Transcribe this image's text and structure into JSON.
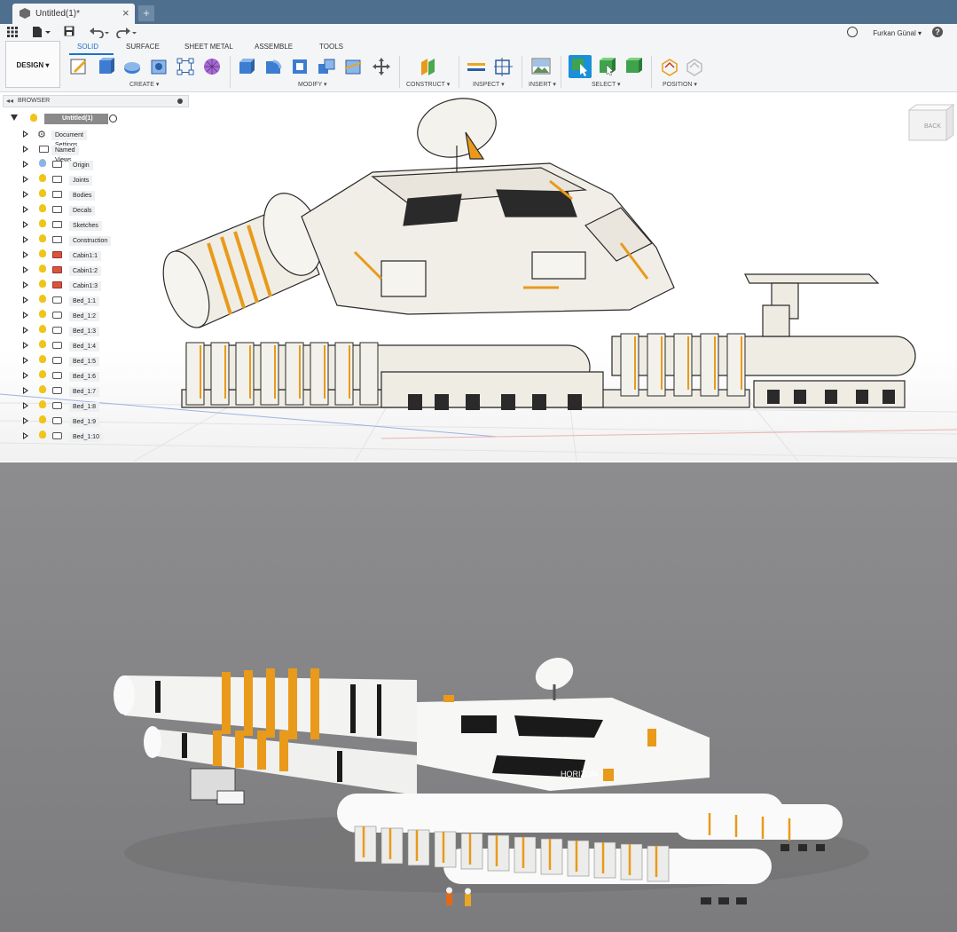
{
  "window": {
    "tab_title": "Untitled(1)*",
    "tab_close": "×",
    "new_tab": "+"
  },
  "user": {
    "name": "Furkan Günal ▾",
    "help": "?"
  },
  "workspace": {
    "mode_label": "DESIGN ▾"
  },
  "workspace_tabs": [
    "SOLID",
    "SURFACE",
    "SHEET METAL",
    "ASSEMBLE",
    "TOOLS"
  ],
  "tool_groups": {
    "create": "CREATE ▾",
    "modify": "MODIFY ▾",
    "construct": "CONSTRUCT ▾",
    "inspect": "INSPECT ▾",
    "insert": "INSERT ▾",
    "select": "SELECT ▾",
    "position": "POSITION ▾"
  },
  "browser": {
    "title": "BROWSER",
    "root": "Untitled(1)",
    "items": [
      "Document Settings",
      "Named Views",
      "Origin",
      "Joints",
      "Bodies",
      "Decals",
      "Sketches",
      "Construction",
      "Cabin1:1",
      "Cabin1:2",
      "Cabin1:3",
      "Bed_1:1",
      "Bed_1:2",
      "Bed_1:3",
      "Bed_1:4",
      "Bed_1:5",
      "Bed_1:6",
      "Bed_1:7",
      "Bed_1:8",
      "Bed_1:9",
      "Bed_1:10"
    ]
  },
  "viewcube": {
    "face": "BACK"
  },
  "colors": {
    "titlebar": "#4f6f8f",
    "accent": "#1f6fd0",
    "select_active": "#1b8fd8",
    "vehicle_orange": "#e99a1a"
  },
  "render": {
    "hull_text": "HORIZON"
  }
}
